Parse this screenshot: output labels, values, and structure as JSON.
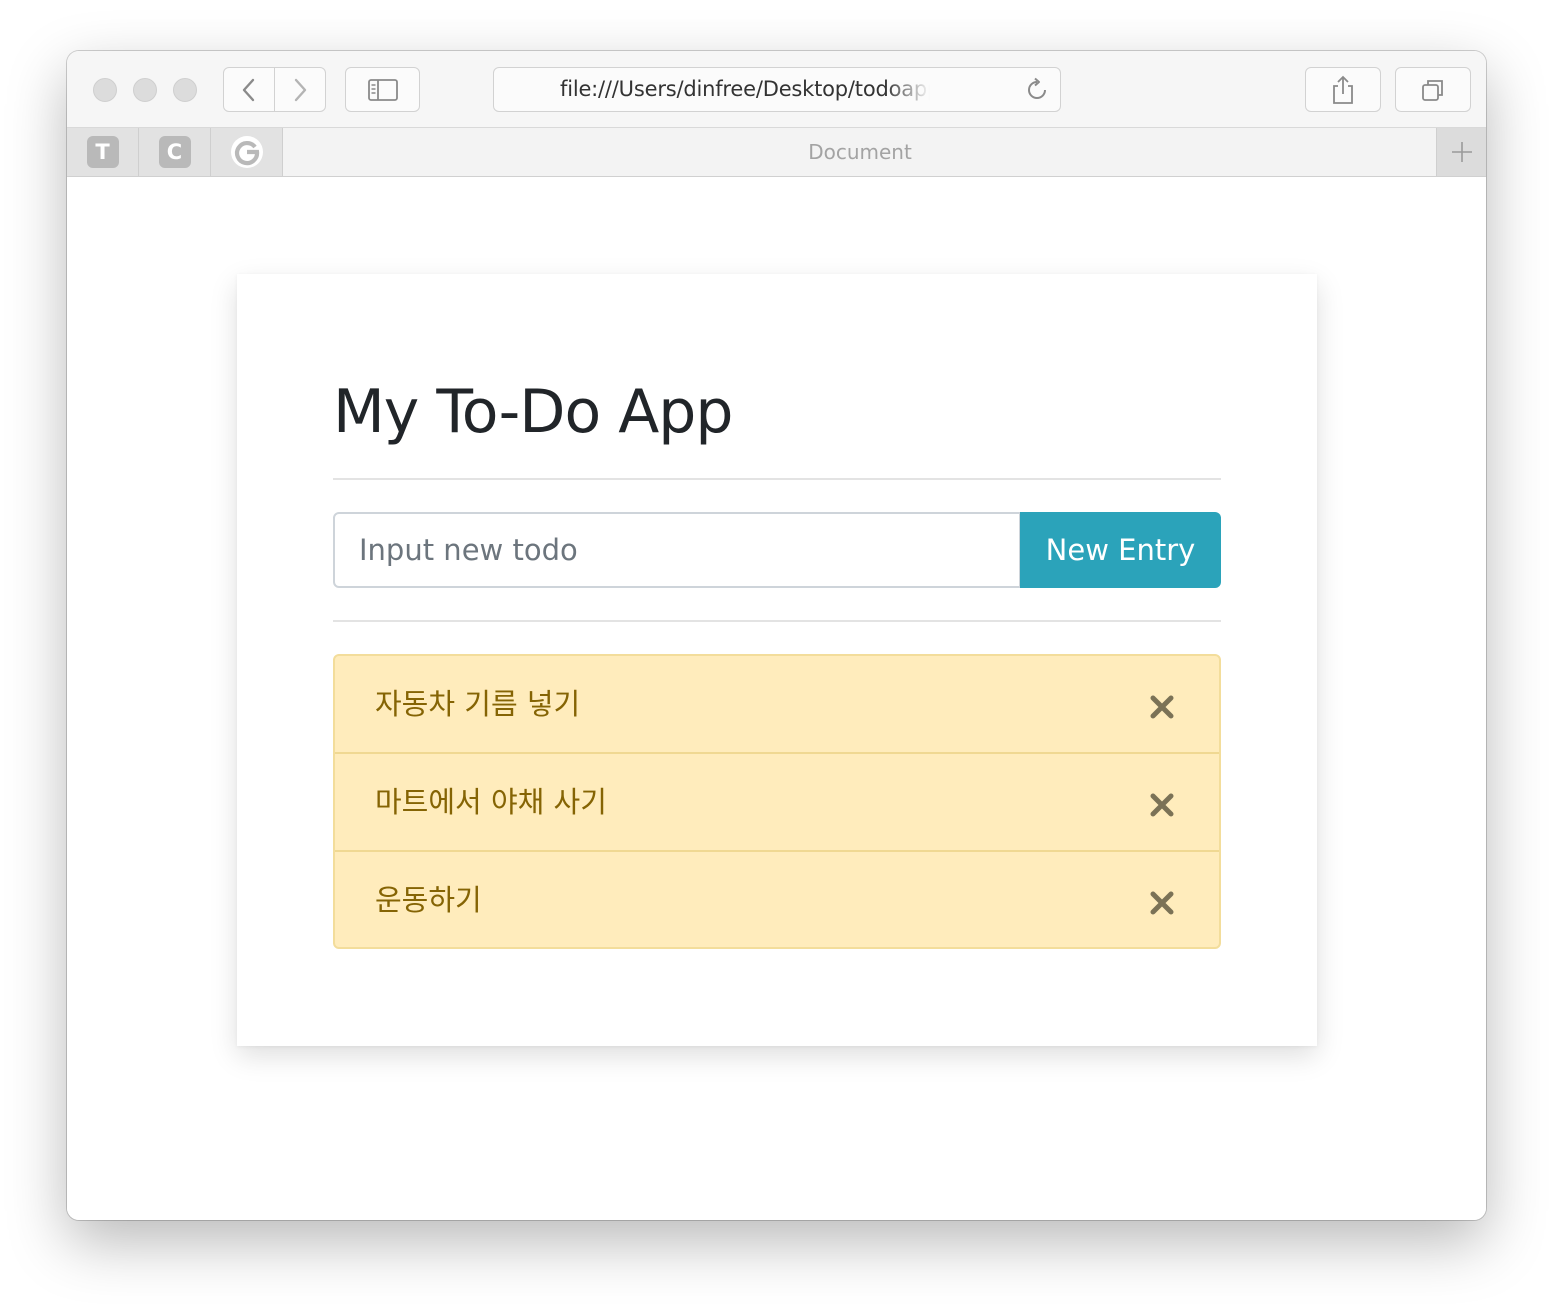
{
  "browser": {
    "url": "file:///Users/dinfree/Desktop/todoapp.h",
    "pinned_tabs": [
      "T",
      "C",
      "G"
    ],
    "active_tab_title": "Document",
    "icons": {
      "back": "chevron-left-icon",
      "forward": "chevron-right-icon",
      "sidebar": "sidebar-icon",
      "reload": "reload-icon",
      "share": "share-icon",
      "tabs": "tab-overview-icon",
      "new_tab": "plus-icon"
    }
  },
  "app": {
    "title": "My To-Do App",
    "input": {
      "placeholder": "Input new todo",
      "value": ""
    },
    "add_button_label": "New Entry",
    "todos": [
      {
        "text": "자동차 기름 넣기"
      },
      {
        "text": "마트에서 야채 사기"
      },
      {
        "text": "운동하기"
      }
    ],
    "delete_icon": "close-icon"
  },
  "colors": {
    "primary_button": "#2ba3ba",
    "todo_background": "#ffecbc",
    "todo_border": "#f3dd9b",
    "todo_text": "#856404",
    "heading_text": "#212529"
  }
}
